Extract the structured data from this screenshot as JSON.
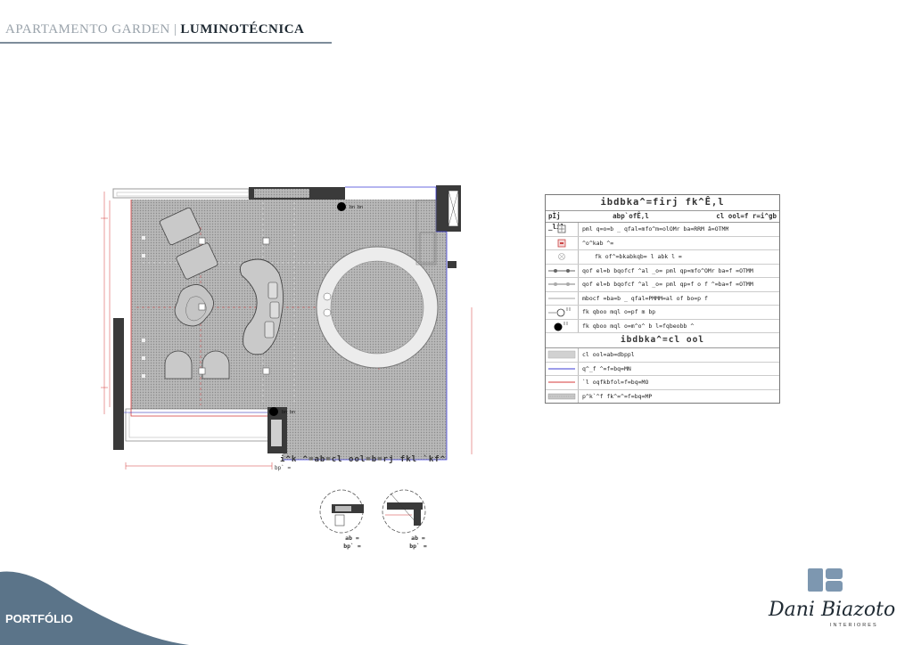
{
  "header": {
    "project": "APARTAMENTO GARDEN",
    "separator": "|",
    "section": "LUMINOTÉCNICA"
  },
  "plan": {
    "title": "i^k ^=ab=cl ool=b=rj fkl  `kf^",
    "subtitle": "bp` =",
    "tags": [
      "bn bn",
      "bn bn"
    ]
  },
  "legend": {
    "title": "ibdbka^=firj fk^Ê,l",
    "col_symbol": "pÌj _lil",
    "col_description": "abp`ofÊ,l",
    "col_height": "cl ool=f r=i^gb",
    "rows": [
      {
        "icon": "square-cross-icon",
        "text": "pml q=o=b _ qfal=mfo^m=olOMr ba=RRM â=OTMM"
      },
      {
        "icon": "square-red-icon",
        "text": "^o^kab ^="
      },
      {
        "icon": "circle-cross-icon",
        "text": "fk of^=bkabkqb= l abk l ="
      },
      {
        "icon": "line-dot-icon",
        "text": "qof el=b bqofcf ^al _o= pml qp=mfo^OMr ba=f =OTMM"
      },
      {
        "icon": "line-dot-grey-icon",
        "text": "qof el=b bqofcf ^al _o= pml qp=f o f ^=ba=f =OTMM"
      },
      {
        "icon": "line-icon",
        "text": "mbocf =ba=b _ qfal=PMMM=al of bo=p f"
      },
      {
        "icon": "dot-open-icon",
        "text": "fk qboo mql o=pf m bp"
      },
      {
        "icon": "dot-filled-icon",
        "text": "fk qboo mql o=m^o^ b l=fqbeobb ^"
      }
    ],
    "sub_title": "ibdbka^=cl ool",
    "sub_rows": [
      {
        "icon": "hatch-icon",
        "text": "cl ool=ab=dbppl"
      },
      {
        "icon": "blue-line-icon",
        "text": "q^_f ^=f=bq=MN"
      },
      {
        "icon": "red-line-icon",
        "text": "`l oqfkbfol=f=bq=MO"
      },
      {
        "icon": "hatch-dark-icon",
        "text": "p^k`^f   fk^=^=f=bq=MP"
      }
    ]
  },
  "details": [
    {
      "label1": "ab =",
      "label2": "bp` ="
    },
    {
      "label1": "ab =",
      "label2": "bp` ="
    }
  ],
  "footer": {
    "portfolio": "PORTFÓLIO",
    "brand": "Dani Biazoto",
    "brand_sub": "INTERIORES"
  },
  "colors": {
    "accent": "#5b7489",
    "logo": "#7d97b0",
    "wall": "#3a3a3a",
    "red_line": "#d43838",
    "blue_line": "#3b3bd6"
  }
}
